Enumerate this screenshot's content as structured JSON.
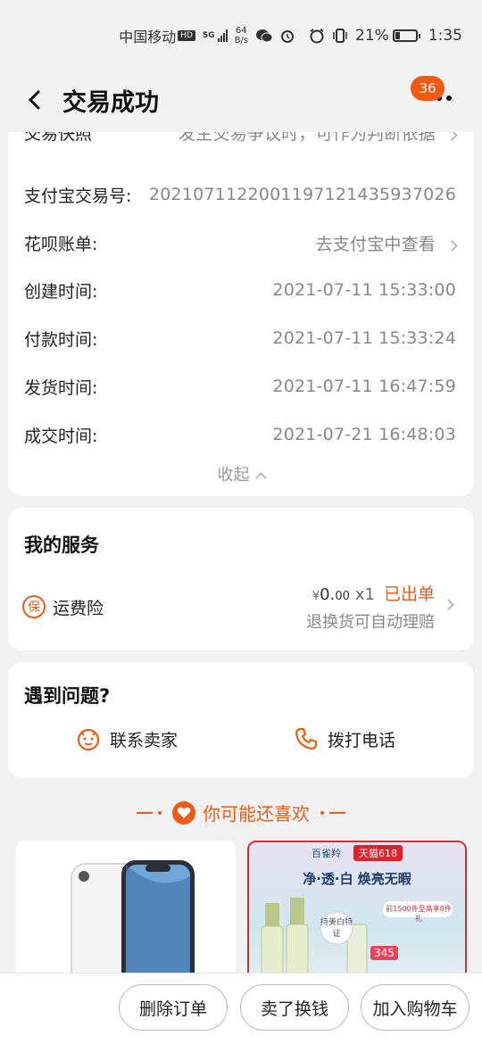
{
  "status_bar": {
    "carrier": "中国移动",
    "hd": "HD",
    "network": "5G",
    "speed_value": "64",
    "speed_unit": "B/s",
    "battery": "21%",
    "time": "1:35"
  },
  "header": {
    "title": "交易成功",
    "more_badge": "36"
  },
  "details": {
    "partial_row_label": "交易快照",
    "partial_row_value": "发生交易争议时，可作为判断依据",
    "rows": [
      {
        "label": "支付宝交易号:",
        "value": "2021071122001197121435937026"
      },
      {
        "label": "花呗账单:",
        "value": "去支付宝中查看"
      },
      {
        "label": "创建时间:",
        "value": "2021-07-11 15:33:00"
      },
      {
        "label": "付款时间:",
        "value": "2021-07-11 15:33:24"
      },
      {
        "label": "发货时间:",
        "value": "2021-07-11 16:47:59"
      },
      {
        "label": "成交时间:",
        "value": "2021-07-21 16:48:03"
      }
    ],
    "collapse_label": "收起"
  },
  "service": {
    "title": "我的服务",
    "icon_char": "保",
    "name": "运费险",
    "price_symbol": "¥",
    "price_int": "0.",
    "price_dec": "00",
    "qty": "x1",
    "status": "已出单",
    "sub": "退换货可自动理赔"
  },
  "help": {
    "title": "遇到问题?",
    "contact_seller": "联系卖家",
    "call_phone": "拨打电话"
  },
  "recommend": {
    "title": "你可能还喜欢",
    "ad_brand": "百雀羚",
    "ad_tmall": "天猫618",
    "ad_slogan": "净·透·白 焕亮无暇",
    "ad_badge": "持美白特证",
    "ad_price": "345",
    "ad_promo": "前1500件至高享8件礼"
  },
  "actions": {
    "delete": "删除订单",
    "sell": "卖了换钱",
    "add_cart": "加入购物车"
  },
  "colors": {
    "accent": "#f05a14",
    "background": "#f2f2f2"
  }
}
